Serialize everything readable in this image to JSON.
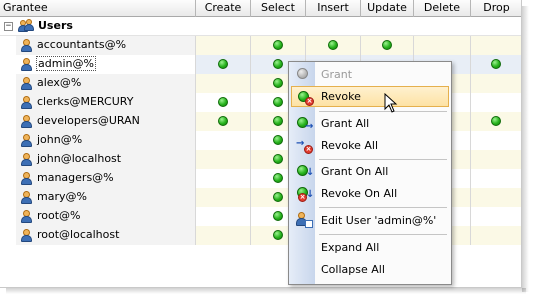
{
  "columns": {
    "grantee": "Grantee",
    "create": "Create",
    "select": "Select",
    "insert": "Insert",
    "update": "Update",
    "delete": "Delete",
    "drop": "Drop"
  },
  "group": {
    "label": "Users",
    "collapse_symbol": "−"
  },
  "rows": [
    {
      "name": "accountants@%"
    },
    {
      "name": "admin@%"
    },
    {
      "name": "alex@%"
    },
    {
      "name": "clerks@MERCURY"
    },
    {
      "name": "developers@URAN"
    },
    {
      "name": "john@%"
    },
    {
      "name": "john@localhost"
    },
    {
      "name": "managers@%"
    },
    {
      "name": "mary@%"
    },
    {
      "name": "root@%"
    },
    {
      "name": "root@localhost"
    }
  ],
  "context_menu": {
    "grant": "Grant",
    "revoke": "Revoke",
    "grant_all": "Grant All",
    "revoke_all": "Revoke All",
    "grant_on_all": "Grant On All",
    "revoke_on_all": "Revoke On All",
    "edit_user": "Edit User 'admin@%'",
    "expand_all": "Expand All",
    "collapse_all": "Collapse All"
  },
  "colors": {
    "granted_dot": "#27b31d",
    "row_highlight": "#fbf9e6",
    "menu_hover": "#fde2a4"
  },
  "icons": {
    "user": "user-icon",
    "group": "users-group-icon",
    "granted": "green-dot-icon"
  }
}
